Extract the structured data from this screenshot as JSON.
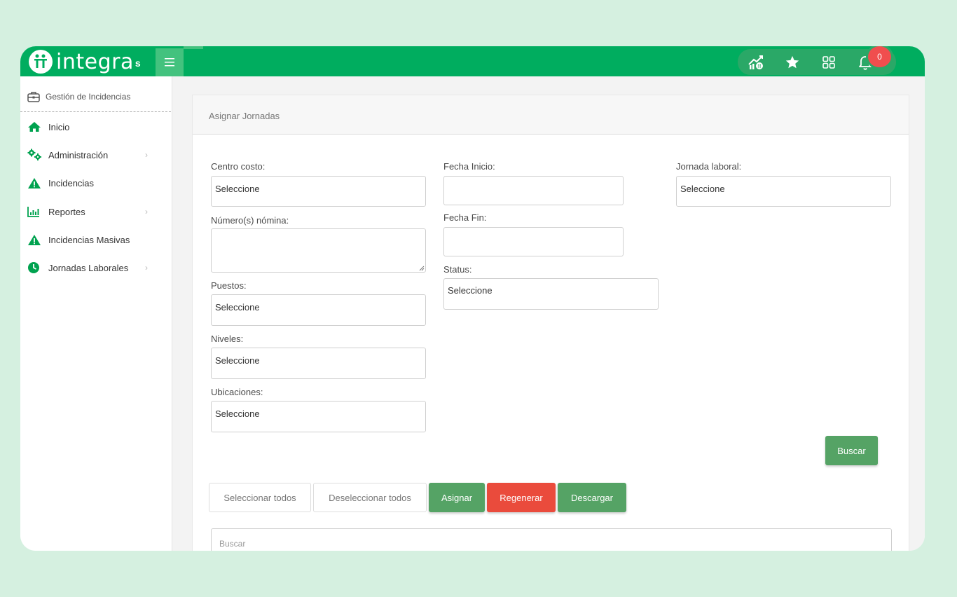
{
  "header": {
    "logo_text": "integra",
    "logo_sub": "s",
    "notification_count": "0",
    "icons": [
      "house-chart-icon",
      "star-icon",
      "grid-icon",
      "bell-icon"
    ]
  },
  "sidebar": {
    "heading": "Gestión de Incidencias",
    "items": [
      {
        "label": "Inicio",
        "icon": "home-icon"
      },
      {
        "label": "Administración",
        "icon": "gears-icon",
        "has_children": true
      },
      {
        "label": "Incidencias",
        "icon": "warning-icon"
      },
      {
        "label": "Reportes",
        "icon": "bar-chart-icon",
        "has_children": true
      },
      {
        "label": "Incidencias Masivas",
        "icon": "warning-icon"
      },
      {
        "label": "Jornadas Laborales",
        "icon": "clock-icon",
        "has_children": true
      }
    ]
  },
  "card": {
    "title": "Asignar Jornadas"
  },
  "form": {
    "centro_costo": {
      "label": "Centro costo:",
      "value": "Seleccione"
    },
    "numero_nomina": {
      "label": "Número(s) nómina:",
      "value": ""
    },
    "puestos": {
      "label": "Puestos:",
      "value": "Seleccione"
    },
    "niveles": {
      "label": "Niveles:",
      "value": "Seleccione"
    },
    "ubicaciones": {
      "label": "Ubicaciones:",
      "value": "Seleccione"
    },
    "fecha_inicio": {
      "label": "Fecha Inicio:",
      "value": ""
    },
    "fecha_fin": {
      "label": "Fecha Fin:",
      "value": ""
    },
    "status": {
      "label": "Status:",
      "value": "Seleccione"
    },
    "jornada_laboral": {
      "label": "Jornada laboral:",
      "value": "Seleccione"
    }
  },
  "actions": {
    "buscar": "Buscar",
    "seleccionar_todos": "Seleccionar todos",
    "deseleccionar_todos": "Deseleccionar todos",
    "asignar": "Asignar",
    "regenerar": "Regenerar",
    "descargar": "Descargar"
  },
  "search": {
    "placeholder": "Buscar"
  },
  "colors": {
    "brand_green": "#00ad5f",
    "button_green": "#55a365",
    "button_red": "#ea4b3c",
    "background": "#d5f0e0"
  }
}
